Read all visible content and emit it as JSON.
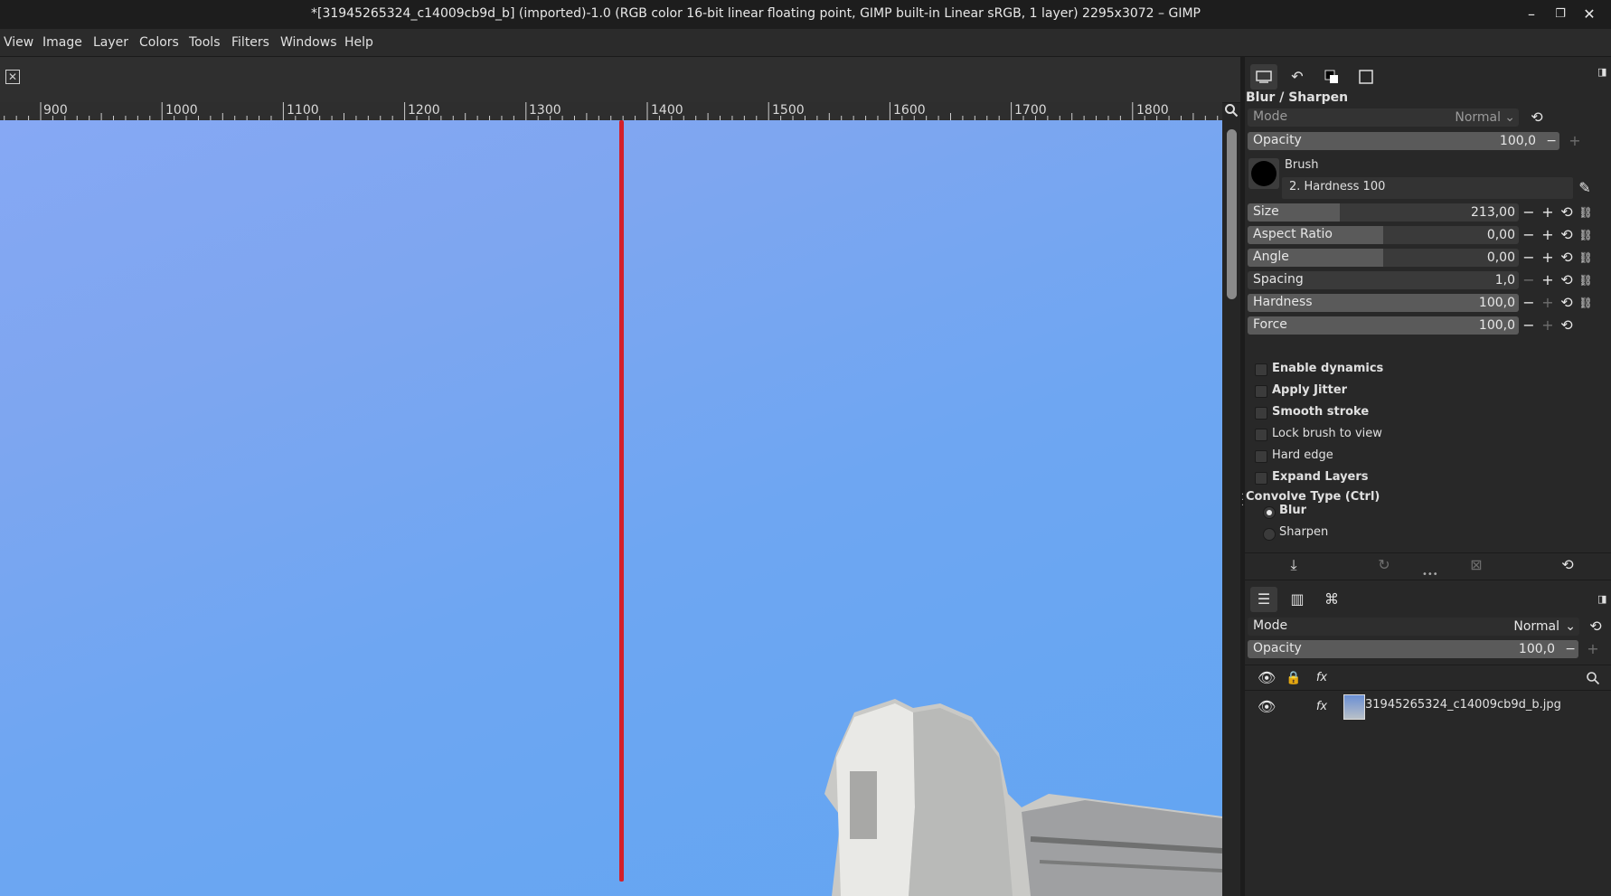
{
  "window": {
    "title": "*[31945265324_c14009cb9d_b] (imported)-1.0 (RGB color 16-bit linear floating point, GIMP built-in Linear sRGB, 1 layer) 2295x3072 – GIMP",
    "minimize": "–",
    "maximize": "❐",
    "close": "✕"
  },
  "menu": [
    "View",
    "Image",
    "Layer",
    "Colors",
    "Tools",
    "Filters",
    "Windows",
    "Help"
  ],
  "tab": {
    "close_icon": "close-icon"
  },
  "ruler": {
    "labels": [
      "900",
      "1000",
      "1100",
      "1200",
      "1300",
      "1400",
      "1500",
      "1600",
      "1700",
      "1800"
    ]
  },
  "tool_options": {
    "title": "Blur / Sharpen",
    "mode_label": "Mode",
    "mode_value": "Normal",
    "opacity": {
      "label": "Opacity",
      "value": "100,0",
      "fraction": 1.0
    },
    "brush_label": "Brush",
    "brush_name": "2. Hardness 100",
    "sliders": [
      {
        "label": "Size",
        "value": "213,00",
        "fraction": 0.34
      },
      {
        "label": "Aspect Ratio",
        "value": "0,00",
        "fraction": 0.5
      },
      {
        "label": "Angle",
        "value": "0,00",
        "fraction": 0.5
      },
      {
        "label": "Spacing",
        "value": "1,0",
        "fraction": 0.0
      },
      {
        "label": "Hardness",
        "value": "100,0",
        "fraction": 1.0
      },
      {
        "label": "Force",
        "value": "100,0",
        "fraction": 1.0
      }
    ],
    "checkboxes": [
      {
        "label": "Enable dynamics",
        "bold": true
      },
      {
        "label": "Apply Jitter",
        "bold": true
      },
      {
        "label": "Smooth stroke",
        "bold": true
      },
      {
        "label": "Lock brush to view",
        "bold": false
      },
      {
        "label": "Hard edge",
        "bold": false
      },
      {
        "label": "Expand Layers",
        "bold": true
      }
    ],
    "convolve_label": "Convolve Type  (Ctrl)",
    "convolve_options": [
      {
        "label": "Blur",
        "selected": true
      },
      {
        "label": "Sharpen",
        "selected": false
      }
    ]
  },
  "layers": {
    "mode_label": "Mode",
    "mode_value": "Normal",
    "opacity_label": "Opacity",
    "opacity_value": "100,0",
    "opacity_fraction": 1.0,
    "items": [
      {
        "name": "31945265324_c14009cb9d_b.jpg"
      }
    ]
  }
}
